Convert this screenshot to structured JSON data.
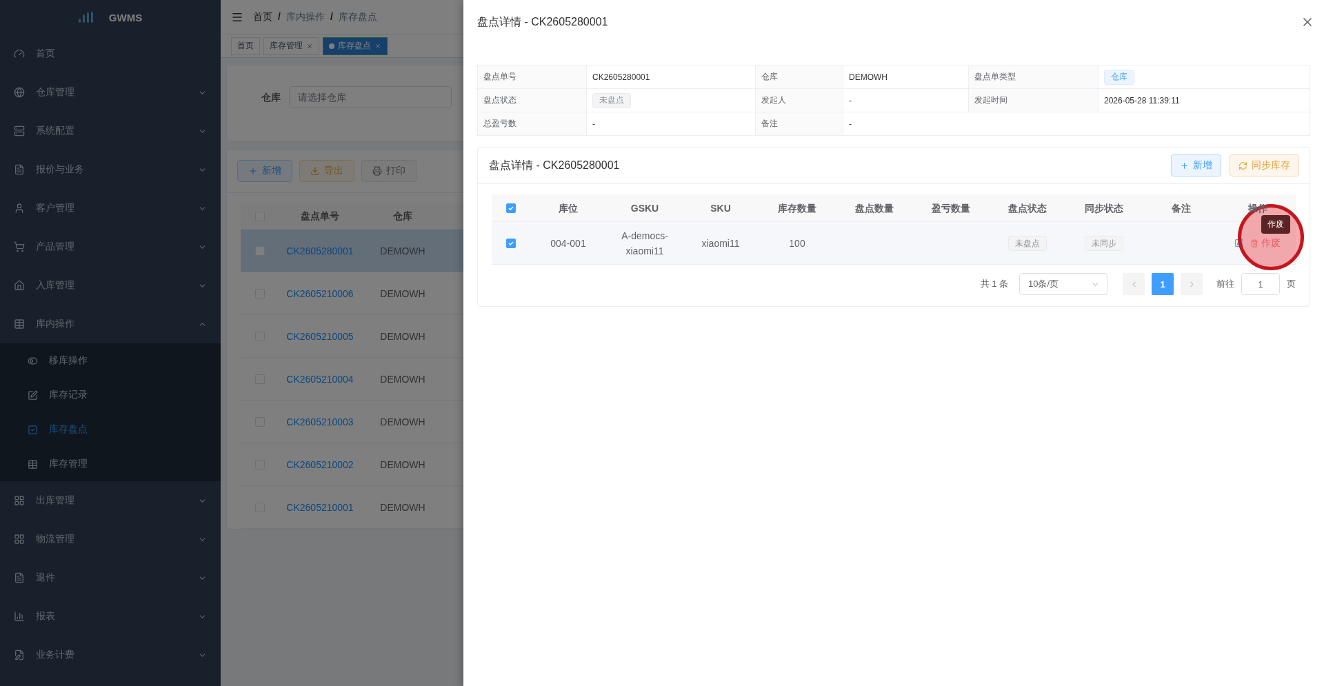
{
  "sidebar": {
    "logo": "GWMS",
    "items": [
      {
        "kind": "link",
        "label": "首页",
        "selected": false
      },
      {
        "kind": "group",
        "label": "仓库管理",
        "expanded": false
      },
      {
        "kind": "group",
        "label": "系统配置",
        "expanded": false
      },
      {
        "kind": "group",
        "label": "报价与业务",
        "expanded": false
      },
      {
        "kind": "group",
        "label": "客户管理",
        "expanded": false
      },
      {
        "kind": "group",
        "label": "产品管理",
        "expanded": false
      },
      {
        "kind": "group",
        "label": "入库管理",
        "expanded": false
      },
      {
        "kind": "group",
        "label": "库内操作",
        "expanded": true,
        "children": [
          {
            "label": "移库操作",
            "selected": false
          },
          {
            "label": "库存记录",
            "selected": false
          },
          {
            "label": "库存盘点",
            "selected": true
          },
          {
            "label": "库存管理",
            "selected": false
          }
        ]
      },
      {
        "kind": "group",
        "label": "出库管理",
        "expanded": false
      },
      {
        "kind": "group",
        "label": "物流管理",
        "expanded": false
      },
      {
        "kind": "group",
        "label": "退件",
        "expanded": false
      },
      {
        "kind": "group",
        "label": "报表",
        "expanded": false
      },
      {
        "kind": "group",
        "label": "业务计费",
        "expanded": false
      }
    ]
  },
  "breadcrumb": {
    "separator": "/",
    "items": [
      "首页",
      "库内操作",
      "库存盘点"
    ]
  },
  "tags": [
    {
      "label": "首页",
      "selected": false,
      "closable": false
    },
    {
      "label": "库存管理",
      "selected": false,
      "closable": true
    },
    {
      "label": "库存盘点",
      "selected": true,
      "closable": true
    }
  ],
  "filter": {
    "label": "仓库",
    "placeholder": "请选择仓库"
  },
  "toolbar": [
    {
      "kind": "primary",
      "label": "新增",
      "disabled": false
    },
    {
      "kind": "warning",
      "label": "导出",
      "disabled": false
    },
    {
      "kind": "print",
      "label": "打印",
      "disabled": true
    }
  ],
  "list_table": {
    "columns": [
      "盘点单号",
      "仓库"
    ],
    "header_checked": false,
    "rows": [
      {
        "id": "CK2605280001",
        "warehouse": "DEMOWH",
        "checked": false,
        "selected": true
      },
      {
        "id": "CK2605210006",
        "warehouse": "DEMOWH",
        "checked": false,
        "selected": false
      },
      {
        "id": "CK2605210005",
        "warehouse": "DEMOWH",
        "checked": false,
        "selected": false
      },
      {
        "id": "CK2605210004",
        "warehouse": "DEMOWH",
        "checked": false,
        "selected": false
      },
      {
        "id": "CK2605210003",
        "warehouse": "DEMOWH",
        "checked": false,
        "selected": false
      },
      {
        "id": "CK2605210002",
        "warehouse": "DEMOWH",
        "checked": false,
        "selected": false
      },
      {
        "id": "CK2605210001",
        "warehouse": "DEMOWH",
        "checked": false,
        "selected": false
      }
    ]
  },
  "drawer": {
    "title": "盘点详情 - CK2605280001",
    "descriptions": [
      {
        "label": "盘点单号",
        "value": "CK2605280001",
        "kind": "text"
      },
      {
        "label": "仓库",
        "value": "DEMOWH",
        "kind": "text"
      },
      {
        "label": "盘点单类型",
        "value": "仓库",
        "kind": "primary-tag"
      },
      {
        "label": "盘点状态",
        "value": "未盘点",
        "kind": "info-tag"
      },
      {
        "label": "发起人",
        "value": "-",
        "kind": "text"
      },
      {
        "label": "发起时间",
        "value": "2026-05-28 11:39:11",
        "kind": "text"
      },
      {
        "label": "总盈亏数",
        "value": "-",
        "kind": "text"
      },
      {
        "label": "备注",
        "value": "-",
        "kind": "text"
      }
    ],
    "card": {
      "title": "盘点详情 - CK2605280001",
      "buttons": [
        {
          "kind": "primary",
          "label": "新增"
        },
        {
          "kind": "warning",
          "label": "同步库存"
        }
      ],
      "table": {
        "header_checked": true,
        "columns": [
          "库位",
          "GSKU",
          "SKU",
          "库存数量",
          "盘点数量",
          "盈亏数量",
          "盘点状态",
          "同步状态",
          "备注",
          "操作"
        ],
        "rows": [
          {
            "checked": true,
            "location": "004-001",
            "gsku": "A-democs-xiaomi11",
            "sku": "xiaomi11",
            "stock": "100",
            "count_status": "未盘点",
            "sync_status": "未同步",
            "action": "作废"
          }
        ]
      },
      "tooltip": "作废",
      "pagination": {
        "total": "共 1 条",
        "page_size": "10条/页",
        "pages": [
          {
            "label": "1",
            "selected": true
          }
        ],
        "goto_label": "前往",
        "goto_value": "1",
        "goto_unit": "页"
      }
    }
  }
}
